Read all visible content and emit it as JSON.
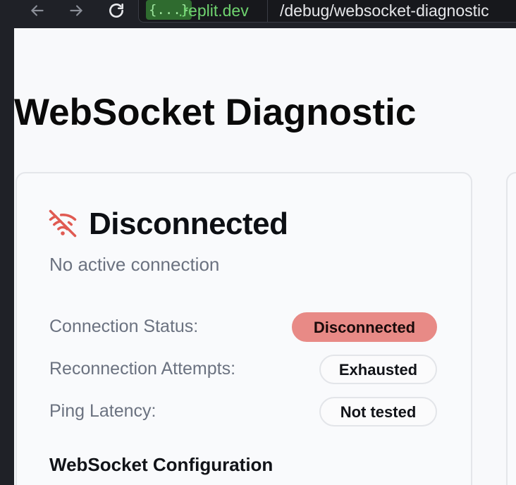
{
  "browser": {
    "url_badge": "{...}",
    "url_host": ".replit.dev",
    "url_path": "/debug/websocket-diagnostic"
  },
  "page": {
    "title": "WebSocket Diagnostic"
  },
  "status_card": {
    "heading": "Disconnected",
    "subtitle": "No active connection",
    "rows": [
      {
        "label": "Connection Status:",
        "value": "Disconnected"
      },
      {
        "label": "Reconnection Attempts:",
        "value": "Exhausted"
      },
      {
        "label": "Ping Latency:",
        "value": "Not tested"
      }
    ],
    "config_title": "WebSocket Configuration"
  },
  "colors": {
    "error_icon": "#e05a52",
    "disconnected_badge": "#e88a86",
    "url_host": "#6fd36f"
  }
}
